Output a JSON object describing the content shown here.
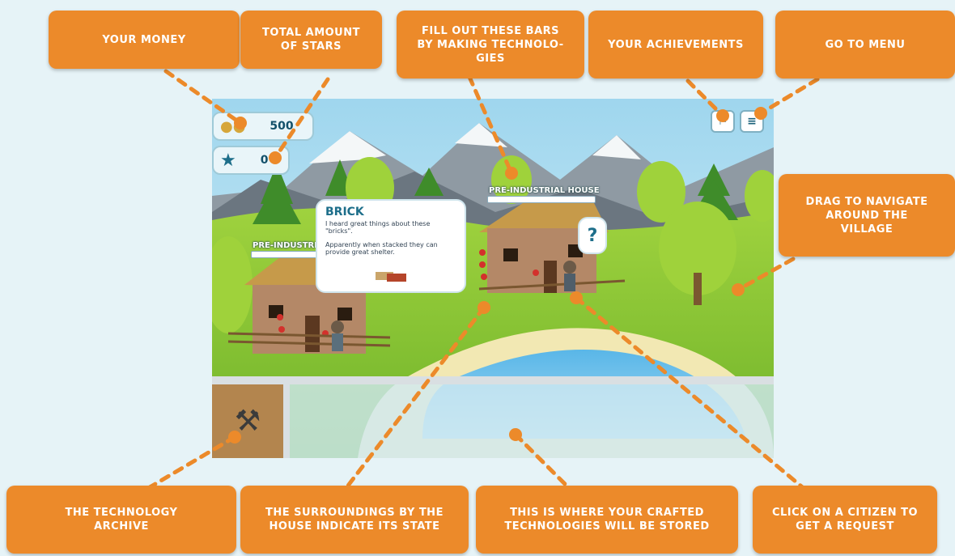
{
  "callouts": {
    "money": "YOUR MONEY",
    "stars": "TOTAL AMOUNT\nOF STARS",
    "bars": "FILL OUT THESE BARS\nBY MAKING TECHNOLO-\nGIES",
    "achievements": "YOUR ACHIEVEMENTS",
    "menu": "GO TO MENU",
    "navigate": "DRAG TO NAVIGATE\nAROUND THE\nVILLAGE",
    "archive": "THE TECHNOLOGY\nARCHIVE",
    "surroundings": "THE SURROUNDINGS BY THE\nHOUSE INDICATE ITS STATE",
    "stored": "THIS IS WHERE YOUR CRAFTED\nTECHNOLOGIES WILL BE STORED",
    "citizen": "CLICK ON A CITIZEN TO\nGET A REQUEST"
  },
  "hud": {
    "money_value": "500",
    "stars_value": "0"
  },
  "houses": {
    "left_label": "PRE-INDUSTRI",
    "right_label": "PRE-INDUSTRIAL HOUSE",
    "left_progress": 0.9,
    "right_progress": 0.9
  },
  "popup": {
    "title": "BRICK",
    "line1": "I heard great things about these \"bricks\".",
    "line2": "Apparently when stacked they can provide great shelter."
  },
  "request_bubble": "?",
  "icons": {
    "coins": "coins-icon",
    "star": "star-icon",
    "achievement": "trophy-icon",
    "menu": "menu-icon",
    "archive": "hammer-chisel-icon",
    "brick": "brick-icon"
  },
  "colors": {
    "callout": "#ec8a2a",
    "dotted_line": "#ec8a2a",
    "hud_text": "#12506a"
  }
}
